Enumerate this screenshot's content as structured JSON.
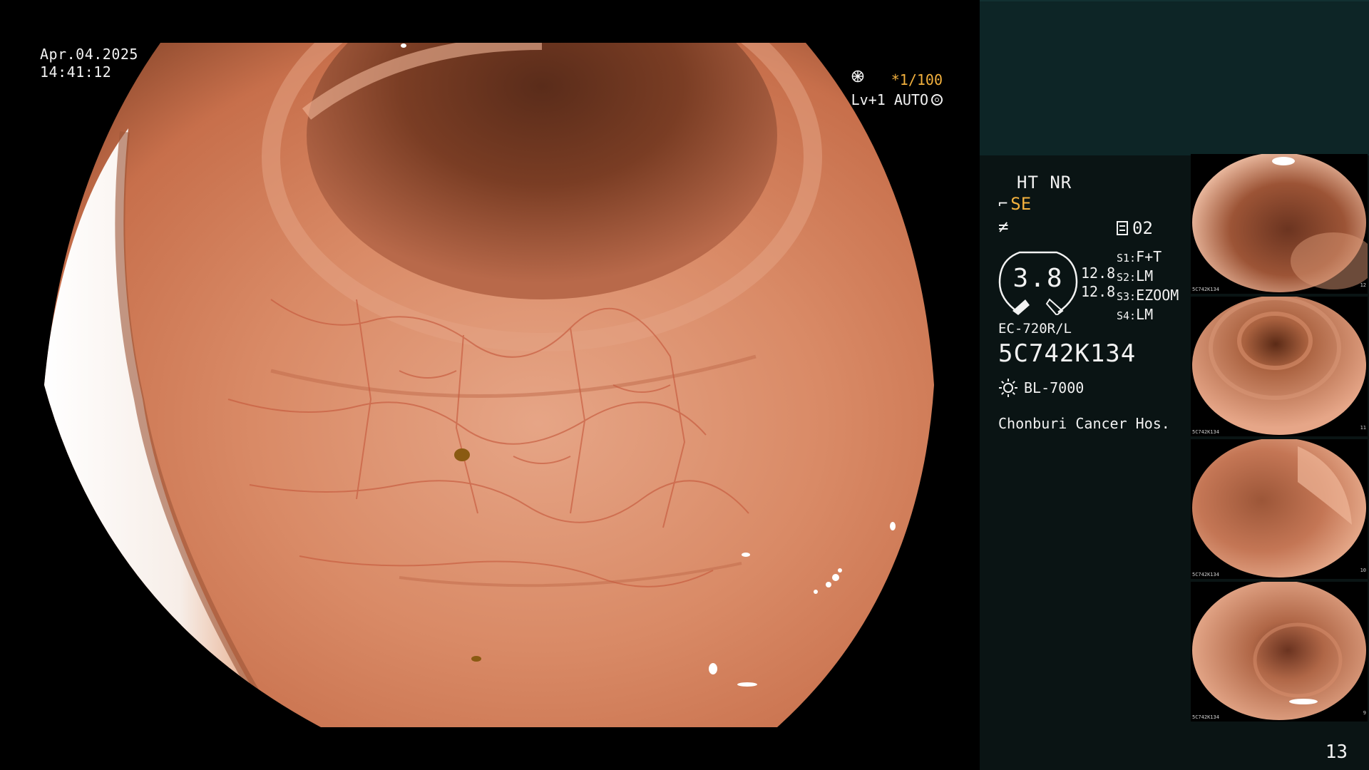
{
  "overlay": {
    "date": "Apr.04.2025",
    "time": "14:41:12",
    "shutter": "*1/100",
    "level": "Lv+1 AUTO"
  },
  "panel": {
    "ht_nr": "HT NR",
    "se": "SE",
    "channel": "02",
    "gauge_value": "3.8",
    "gauge_nums": [
      "12.8",
      "12.8"
    ],
    "scope_settings": [
      {
        "key": "S1:",
        "value": "F+T"
      },
      {
        "key": "S2:",
        "value": "LM"
      },
      {
        "key": "S3:",
        "value": "EZOOM"
      },
      {
        "key": "S4:",
        "value": "LM"
      }
    ],
    "model": "EC-720R/L",
    "serial": "5C742K134",
    "light_source": "BL-7000",
    "hospital": "Chonburi Cancer Hos."
  },
  "thumbnails": [
    {
      "label": "5C742K134",
      "number": "12"
    },
    {
      "label": "5C742K134",
      "number": "11"
    },
    {
      "label": "5C742K134",
      "number": "10"
    },
    {
      "label": "5C742K134",
      "number": "9"
    }
  ],
  "page_number": "13",
  "colors": {
    "accent": "#f3b13e",
    "panel_teal": "#0d2526",
    "panel_dark": "#0a1414",
    "mucosa": "#d9825f"
  },
  "icons": {
    "shutter": "shutter-icon",
    "level": "iris-icon",
    "se": "hook-icon",
    "channel": "document-icon",
    "light": "sun-icon"
  }
}
